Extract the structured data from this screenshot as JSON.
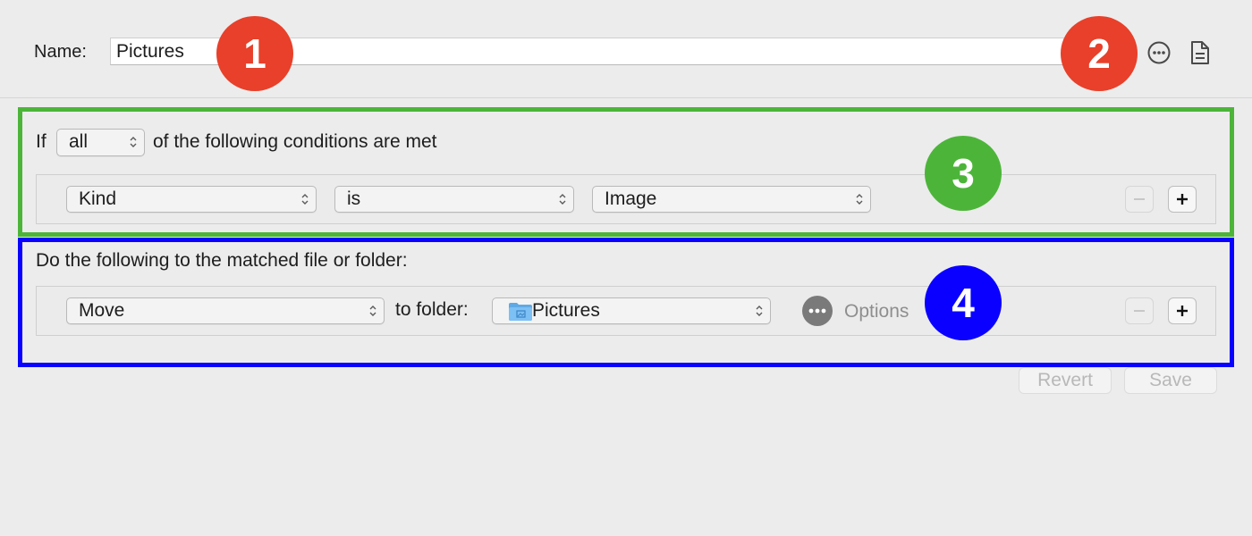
{
  "name_row": {
    "label": "Name:",
    "value": "Pictures",
    "more_icon": "ellipsis-circle-icon",
    "doc_icon": "document-icon"
  },
  "conditions": {
    "prefix": "If",
    "match_value": "all",
    "suffix": "of the following conditions are met",
    "rule": {
      "attribute": "Kind",
      "operator": "is",
      "value": "Image"
    }
  },
  "actions": {
    "header": "Do the following to the matched file or folder:",
    "action": "Move",
    "to_folder_label": "to folder:",
    "folder_value": "Pictures",
    "options_label": "Options"
  },
  "footer": {
    "revert_label": "Revert",
    "save_label": "Save"
  },
  "callouts": {
    "one": "1",
    "two": "2",
    "three": "3",
    "four": "4"
  },
  "colors": {
    "red_callout": "#e8402a",
    "green_callout": "#4cb539",
    "blue_callout": "#0a00ff"
  }
}
